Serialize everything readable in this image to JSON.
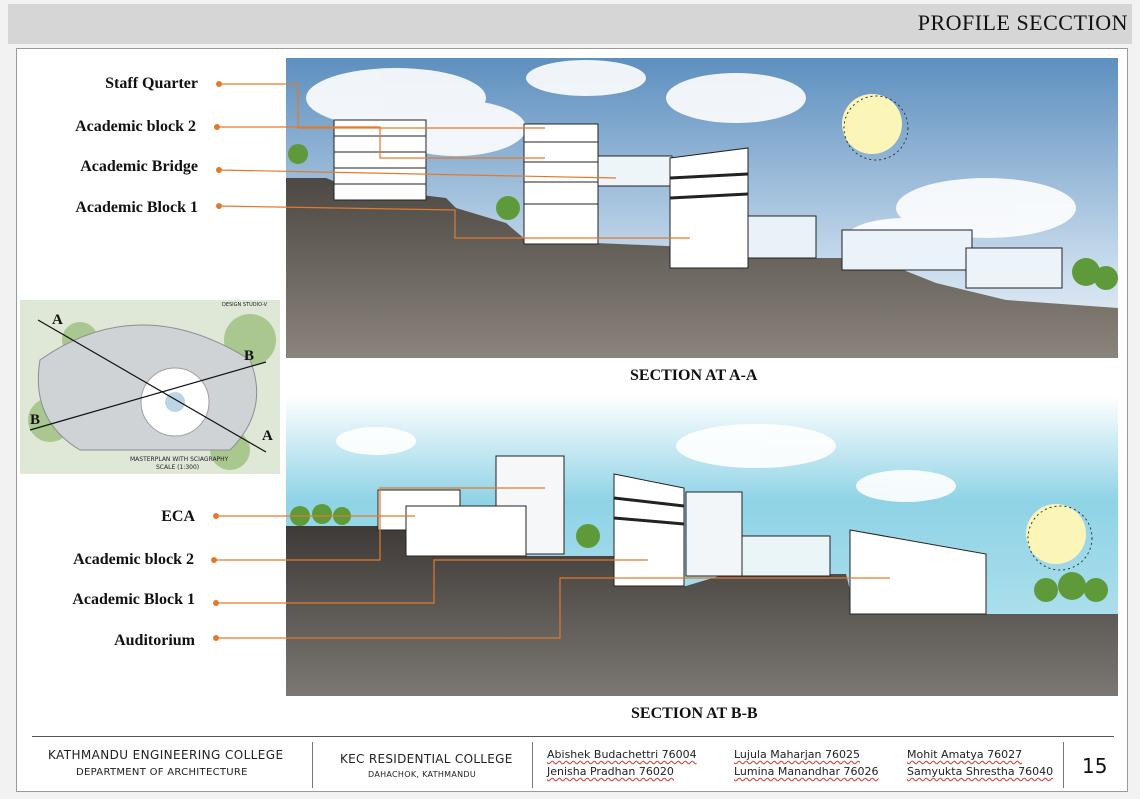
{
  "header": {
    "title": "PROFILE SECCTION"
  },
  "section_aa": {
    "caption": "SECTION AT A-A",
    "labels": [
      "Staff Quarter",
      "Academic block 2",
      "Academic Bridge",
      "Academic Block 1"
    ]
  },
  "section_bb": {
    "caption": "SECTION AT B-B",
    "labels": [
      "ECA",
      "Academic block 2",
      "Academic Block 1",
      "Auditorium"
    ]
  },
  "masterplan": {
    "studio": "DESIGN STUDIO-V",
    "caption_line1": "MASTERPLAN WITH SCIAGRAPHY",
    "caption_line2": "SCALE (1:300)",
    "marker_a": "A",
    "marker_b": "B"
  },
  "footer": {
    "college": "KATHMANDU ENGINEERING COLLEGE",
    "department": "DEPARTMENT OF ARCHITECTURE",
    "project": "KEC RESIDENTIAL COLLEGE",
    "location": "DAHACHOK, KATHMANDU",
    "members": [
      "Abishek Budachettri 76004",
      "Jenisha Pradhan 76020",
      "Lujula Maharjan 76025",
      "Lumina Manandhar 76026",
      "Mohit Amatya 76027",
      "Samyukta Shrestha 76040"
    ],
    "page_number": "15"
  },
  "colors": {
    "leader": "#e07a2e",
    "sky_top": "#6a98c4",
    "sky_bb": "#8fd3e6",
    "ground": "#5f5a55",
    "sun": "#fbf5b8"
  }
}
